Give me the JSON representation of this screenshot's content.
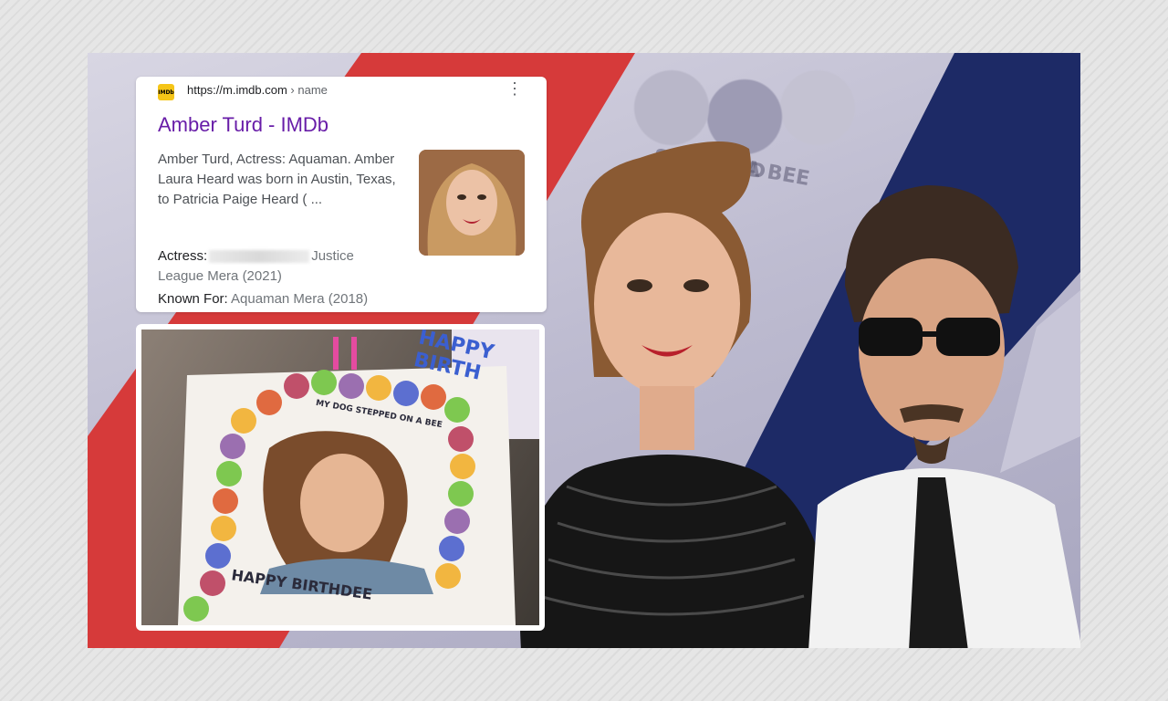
{
  "snippet": {
    "favicon_text": "IMDb",
    "url_host": "https://m.imdb.com",
    "url_path": " › name",
    "more_icon": "more-vert-icon",
    "title": "Amber Turd - IMDb",
    "description": "Amber Turd, Actress: Aquaman. Amber Laura Heard was born in Austin, Texas, to Patricia Paige Heard ( ...",
    "actress_label": "Actress:",
    "actress_value": "Justice League Mera (2021)",
    "known_label": "Known For:",
    "known_value": "Aquaman Mera (2018)"
  },
  "cake": {
    "top_text": "HAPPY BIRTH",
    "caption_text": "MY DOG STEPPED ON A BEE",
    "bottom_text": "HAPPY BIRTHDEE"
  },
  "background": {
    "banner_text": "STEPPED",
    "banner_text_2": "A BEE"
  },
  "colors": {
    "red": "#d63a3a",
    "navy": "#1d2a66",
    "purple_link": "#681da8"
  }
}
